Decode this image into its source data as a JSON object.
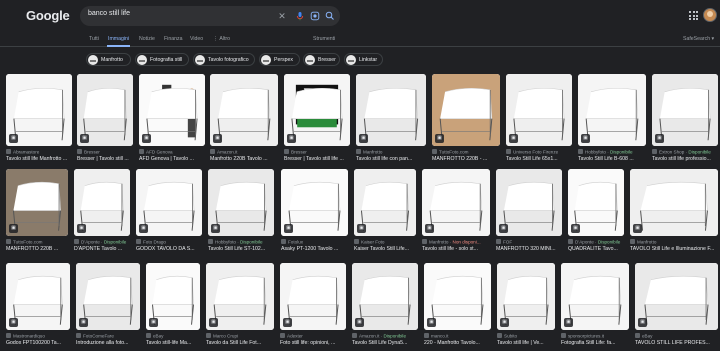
{
  "header": {
    "logo": "Google",
    "query": "banco still life"
  },
  "tabs": [
    {
      "label": "Tutti",
      "active": false
    },
    {
      "label": "Immagini",
      "active": true
    },
    {
      "label": "Notizie",
      "active": false
    },
    {
      "label": "Finanza",
      "active": false
    },
    {
      "label": "Video",
      "active": false
    },
    {
      "label": "⋮ Altro",
      "active": false
    },
    {
      "label": "Strumenti",
      "active": false
    },
    {
      "label": "SafeSearch ▾",
      "active": false
    }
  ],
  "chips": [
    {
      "label": "Manfrotto"
    },
    {
      "label": "Fotografia still"
    },
    {
      "label": "Tavolo fotografico"
    },
    {
      "label": "Perspex"
    },
    {
      "label": "Bresser"
    },
    {
      "label": "Linkstar"
    }
  ],
  "results": [
    {
      "source": "Abramastore",
      "title": "Tavolo still life Manfrotto ...",
      "status": ""
    },
    {
      "source": "Bresser",
      "title": "Bresser | Tavolo still ...",
      "status": ""
    },
    {
      "source": "AFD Genova",
      "title": "AFD Genova | Tavolo ...",
      "status": ""
    },
    {
      "source": "Amazon.it",
      "title": "Manfrotto 220B Tavolo ...",
      "status": ""
    },
    {
      "source": "Bresser",
      "title": "Bresser | Tavolo still life ...",
      "status": ""
    },
    {
      "source": "Manfrotto",
      "title": "Tavolo still life con pan...",
      "status": ""
    },
    {
      "source": "TuttoFoto.com",
      "title": "MANFROTTO 220B - ...",
      "status": ""
    },
    {
      "source": "Universo Foto Firenze",
      "title": "Tavolo Still Life 65x1...",
      "status": ""
    },
    {
      "source": "Hobbyfoto",
      "title": "Tavolo Still Life B-608 ...",
      "status": "Disponibile"
    },
    {
      "source": "Extron Shop",
      "title": "Tavolo still life professio...",
      "status": "Disponibile"
    },
    {
      "source": "TuttoFoto.com",
      "title": "MANFROTTO 220B ...",
      "status": ""
    },
    {
      "source": "D'Aponte",
      "title": "D'APONTE Tavolo ...",
      "status": "Disponibile"
    },
    {
      "source": "Foto Drago",
      "title": "GODOX TAVOLO DA S...",
      "status": ""
    },
    {
      "source": "Hobbyfoto",
      "title": "Tavolo Still Life ST-102...",
      "status": "Disponibile"
    },
    {
      "source": "Fotolux",
      "title": "Asaky PT-1200 Tavolo ...",
      "status": ""
    },
    {
      "source": "Kaiser Foto",
      "title": "Kaiser Tavolo Still Life...",
      "status": ""
    },
    {
      "source": "Manfrotto",
      "title": "Tavolo still life - solo st...",
      "status": "Non disponi..."
    },
    {
      "source": "FOF",
      "title": "MANFROTTO 320 MINI...",
      "status": ""
    },
    {
      "source": "D'Aponte",
      "title": "QUADRALITE Tavo...",
      "status": "Disponibile"
    },
    {
      "source": "Manfrotto",
      "title": "TAVOLO Still Life e Illuminazione F...",
      "status": ""
    },
    {
      "source": "Mastronardiquo",
      "title": "Godox FPT100200 Ta...",
      "status": ""
    },
    {
      "source": "FotoComeFare",
      "title": "Introduzione alla foto...",
      "status": ""
    },
    {
      "source": "eBay",
      "title": "Tavolo still-life Ma...",
      "status": ""
    },
    {
      "source": "Marco Crupi",
      "title": "Tavolo da Still Life Fot...",
      "status": ""
    },
    {
      "source": "Adexter",
      "title": "Foto still life: opinioni, ...",
      "status": ""
    },
    {
      "source": "Amazon.it",
      "title": "Tavolo Still Life Dyna5...",
      "status": "Disponibile"
    },
    {
      "source": "manco.it",
      "title": "220 - Manfrotto Tavolo...",
      "status": ""
    },
    {
      "source": "Subito",
      "title": "Tavolo still life | Ve...",
      "status": ""
    },
    {
      "source": "sponsorpictures.it",
      "title": "Fotografia Still Life: fa...",
      "status": ""
    },
    {
      "source": "eBay",
      "title": "TAVOLO STILL LIFE PROFES...",
      "status": ""
    }
  ]
}
